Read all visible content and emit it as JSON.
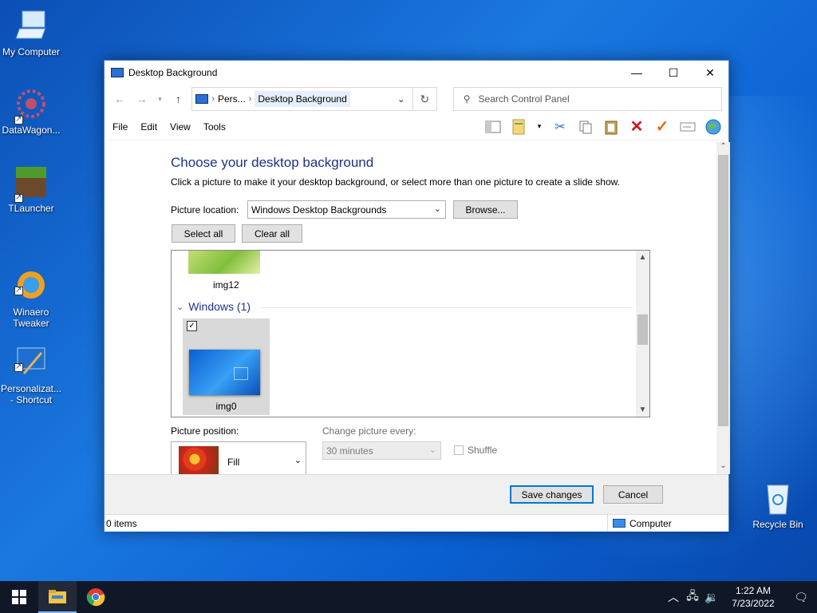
{
  "desktop": {
    "icons": [
      {
        "label": "My Computer"
      },
      {
        "label": "DataWagon..."
      },
      {
        "label": "TLauncher"
      },
      {
        "label": "Winaero\nTweaker"
      },
      {
        "label": "Personalizat...\n- Shortcut"
      },
      {
        "label": "Recycle Bin"
      }
    ]
  },
  "window": {
    "title": "Desktop Background",
    "controls": {
      "minimize": "—",
      "maximize": "☐",
      "close": "✕"
    },
    "address": {
      "crumbs": [
        "Pers...",
        "Desktop Background"
      ]
    },
    "search": {
      "placeholder": "Search Control Panel"
    },
    "menu": [
      "File",
      "Edit",
      "View",
      "Tools"
    ],
    "heading": "Choose your desktop background",
    "subheading": "Click a picture to make it your desktop background, or select more than one picture to create a slide show.",
    "picture_location": {
      "label": "Picture location:",
      "value": "Windows Desktop Backgrounds",
      "browse": "Browse..."
    },
    "select_all": "Select all",
    "clear_all": "Clear all",
    "gallery": {
      "items_above": [
        {
          "name": "img12"
        }
      ],
      "group": {
        "name": "Windows (1)",
        "items": [
          {
            "name": "img0",
            "checked": true
          }
        ]
      }
    },
    "picture_position": {
      "label": "Picture position:",
      "value": "Fill"
    },
    "change_every": {
      "label": "Change picture every:",
      "value": "30 minutes"
    },
    "shuffle": {
      "label": "Shuffle",
      "checked": false
    },
    "buttons": {
      "save": "Save changes",
      "cancel": "Cancel"
    },
    "status": {
      "items": "0 items",
      "location": "Computer"
    }
  },
  "taskbar": {
    "time": "1:22 AM",
    "date": "7/23/2022"
  },
  "colors": {
    "accent_heading": "#1e3287",
    "taskbar": "#101828"
  }
}
